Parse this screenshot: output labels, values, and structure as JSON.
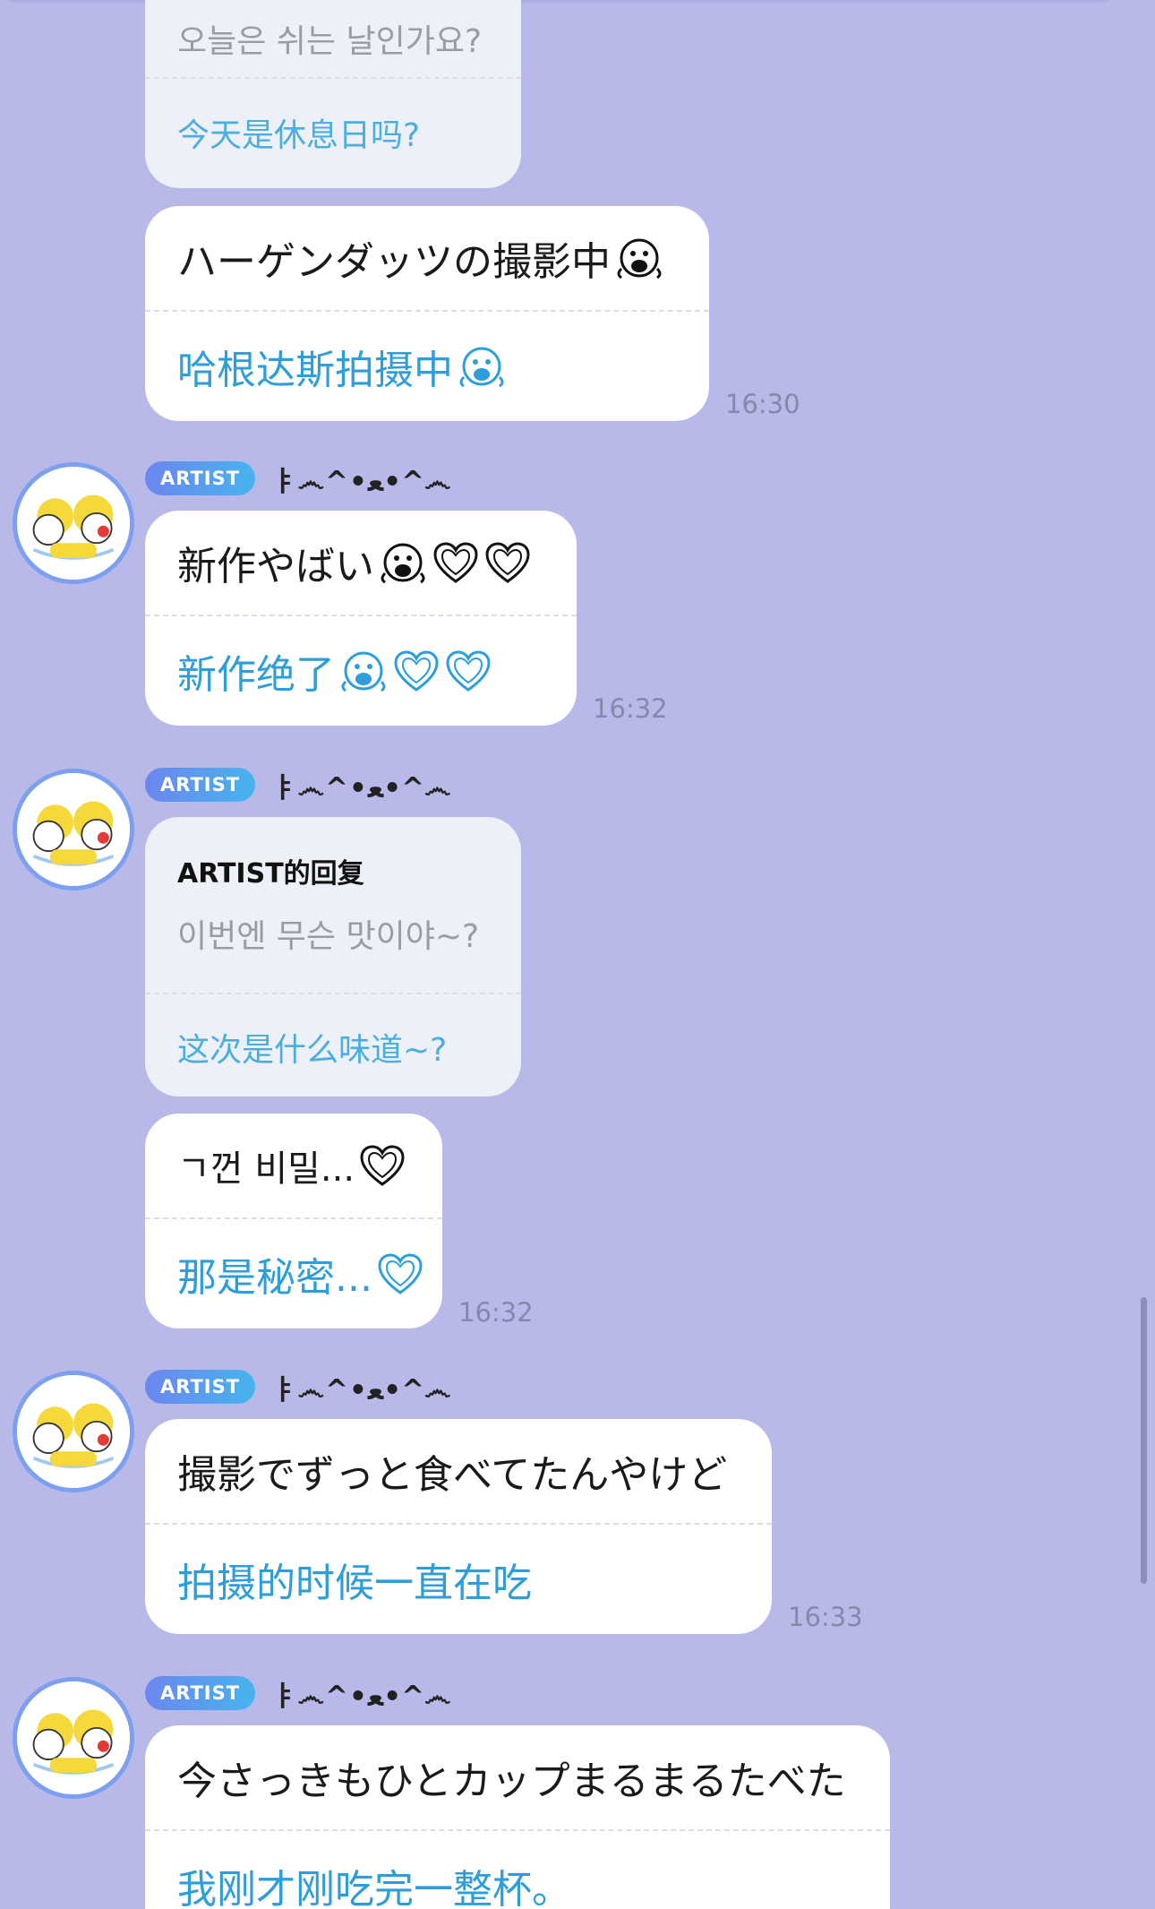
{
  "artist": {
    "badge": "ARTIST",
    "name": "ㅑ෴^•ﻌ•^෴"
  },
  "messages": [
    {
      "type": "reply-partial",
      "original": "오늘은 쉬는 날인가요?",
      "translation": "今天是休息日吗?"
    },
    {
      "type": "text",
      "original": "ハーゲンダッツの撮影中",
      "translation": "哈根达斯拍摄中",
      "emoji": [
        "face-emoji"
      ],
      "time": "16:30"
    },
    {
      "type": "text",
      "original": "新作やばい",
      "translation": "新作绝了",
      "emoji": [
        "face-emoji",
        "heart",
        "heart"
      ],
      "time": "16:32"
    },
    {
      "type": "reply",
      "label": "ARTIST的回复",
      "original": "이번엔 무슨 맛이야~?",
      "translation": "这次是什么味道~?"
    },
    {
      "type": "text",
      "original": "ㄱ껀 비밀...",
      "translation": "那是秘密...",
      "emoji": [
        "heart"
      ],
      "time": "16:32"
    },
    {
      "type": "text",
      "original": "撮影でずっと食べてたんやけど",
      "translation": "拍摄的时候一直在吃",
      "time": "16:33"
    },
    {
      "type": "text",
      "original": "今さっきもひとカップまるまるたべた",
      "translation": "我刚才刚吃完一整杯。"
    }
  ],
  "colors": {
    "background": "#b8b9e9",
    "translation_text": "#2d9ddb",
    "badge_start": "#6c86ef",
    "badge_end": "#46b4ee"
  }
}
